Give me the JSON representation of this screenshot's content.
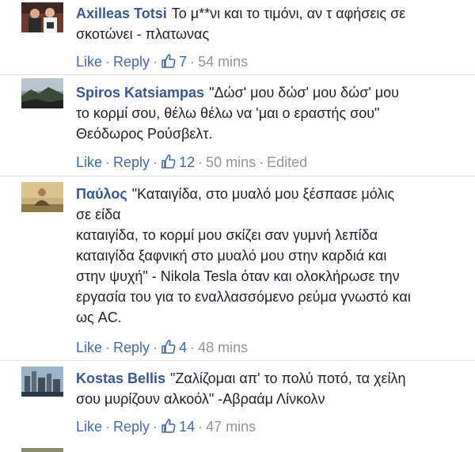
{
  "comments": [
    {
      "author": "Axilleas Totsi",
      "text": "Το μ**νι και το τιμόνι, αν τ αφήσεις σε\nσκοτώνει - πλατωνας",
      "like_label": "Like",
      "reply_label": "Reply",
      "likes": "7",
      "time": "54 mins",
      "edited": ""
    },
    {
      "author": "Spiros Katsiampas",
      "text": "\"Δώσ' μου δώσ' μου δώσ' μου\nτο κορμί σου, θέλω θέλω να 'μαι ο εραστής σου\"\nΘεόδωρος Ρούσβελτ.",
      "like_label": "Like",
      "reply_label": "Reply",
      "likes": "12",
      "time": "50 mins",
      "edited": "Edited"
    },
    {
      "author": "Παύλος",
      "text": "\"Καταιγίδα, στο μυαλό μου ξέσπασε μόλις\nσε είδα\nκαταιγίδα, το κορμί μου σκίζει σαν γυμνή λεπίδα\nκαταιγίδα ξαφνική στο μυαλό μου στην καρδιά και\nστην ψυχή\" - Nikola Tesla όταν και ολοκλήρωσε την\nεργασία του για το εναλλασσόμενο ρεύμα γνωστό και\nως AC.",
      "like_label": "Like",
      "reply_label": "Reply",
      "likes": "4",
      "time": "48 mins",
      "edited": ""
    },
    {
      "author": "Kostas Bellis",
      "text": "\"Ζαλίζομαι απ' το πολύ ποτό, τα χείλη\nσου μυρίζουν αλκοόλ\" -Αβραάμ Λίνκολν",
      "like_label": "Like",
      "reply_label": "Reply",
      "likes": "14",
      "time": "47 mins",
      "edited": ""
    }
  ],
  "colors": {
    "author": "#365899",
    "action_link": "#4267b2",
    "meta": "#90949c",
    "text": "#1d2129"
  },
  "icons": {
    "like": "thumbs-up-icon"
  }
}
